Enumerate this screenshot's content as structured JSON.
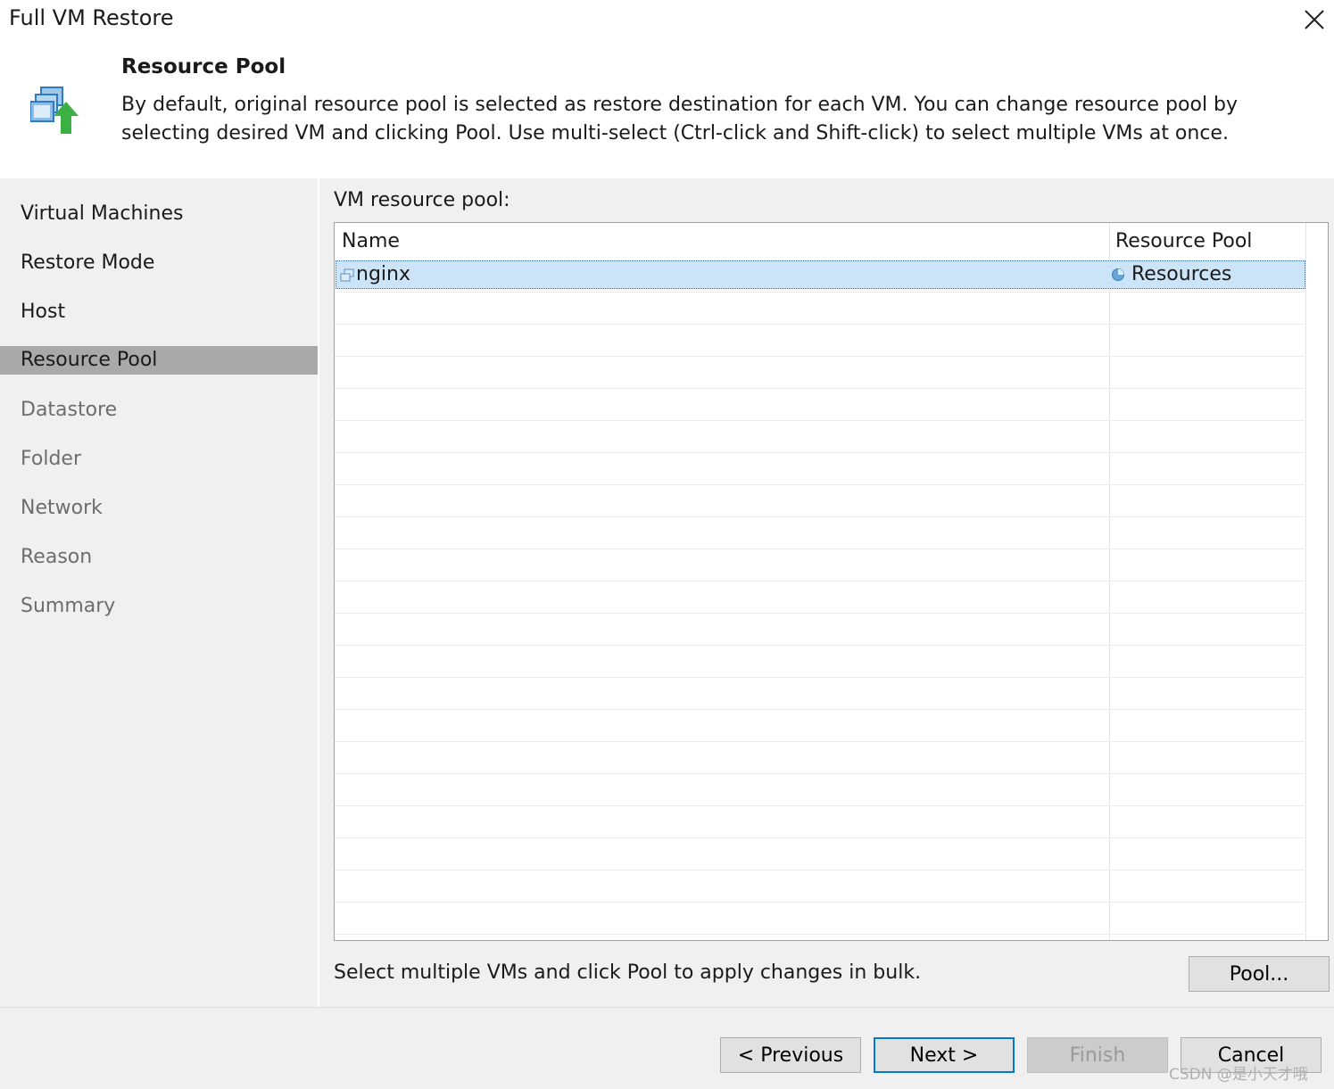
{
  "window": {
    "title": "Full VM Restore"
  },
  "header": {
    "heading": "Resource Pool",
    "description": "By default, original resource pool is selected as restore destination for each VM. You can change resource pool by selecting desired VM and clicking Pool. Use multi-select (Ctrl-click and Shift-click) to select multiple VMs at once."
  },
  "sidebar": {
    "items": [
      {
        "label": "Virtual Machines",
        "state": "done"
      },
      {
        "label": "Restore Mode",
        "state": "done"
      },
      {
        "label": "Host",
        "state": "done"
      },
      {
        "label": "Resource Pool",
        "state": "active"
      },
      {
        "label": "Datastore",
        "state": "todo"
      },
      {
        "label": "Folder",
        "state": "todo"
      },
      {
        "label": "Network",
        "state": "todo"
      },
      {
        "label": "Reason",
        "state": "todo"
      },
      {
        "label": "Summary",
        "state": "todo"
      }
    ]
  },
  "main": {
    "grid_label": "VM resource pool:",
    "columns": [
      "Name",
      "Resource Pool"
    ],
    "rows": [
      {
        "name": "nginx",
        "name_icon": "vm-icon",
        "pool": "Resources",
        "pool_icon": "resource-pool-icon",
        "selected": true
      }
    ],
    "bulk_hint": "Select multiple VMs and click Pool to apply changes in bulk.",
    "pool_button": "Pool..."
  },
  "footer": {
    "previous": "< Previous",
    "next": "Next >",
    "finish": "Finish",
    "cancel": "Cancel"
  },
  "watermark": "CSDN @是小天才哦",
  "colors": {
    "selection": "#cce4f7",
    "active_nav": "#a9a9a9",
    "accent": "#0078d7",
    "arrow_green": "#3cb043"
  }
}
